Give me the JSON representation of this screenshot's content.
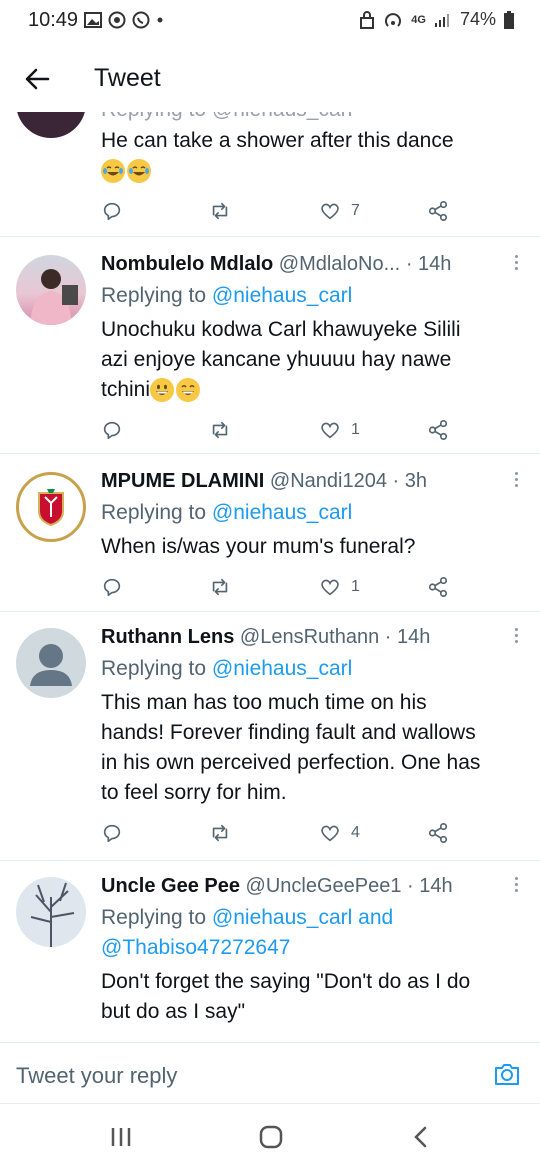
{
  "status": {
    "time": "10:49",
    "network": "4G",
    "battery": "74%"
  },
  "header": {
    "title": "Tweet"
  },
  "tweets": [
    {
      "partial_reply": "Replying to @niehaus_carl",
      "text": "He can take a shower after this dance",
      "emojis": [
        "joy-emoji",
        "joy-emoji"
      ],
      "likes": "7"
    },
    {
      "name": "Nombulelo Mdlalo",
      "handle": "@MdlaloNo...",
      "time": "· 14h",
      "replying_prefix": "Replying to",
      "mention": "@niehaus_carl",
      "text": "Unochuku kodwa Carl khawuyeke Sililiazi enjoye kancane yhuuuu hay nawetchini",
      "text_lines": [
        "Unochuku kodwa Carl khawuyeke Silili",
        "azi enjoye kancane yhuuuu hay nawe",
        "tchini"
      ],
      "emojis": [
        "grinning-emoji",
        "grin-emoji"
      ],
      "likes": "1"
    },
    {
      "name": "MPUME DLAMINI",
      "handle": "@Nandi1204",
      "time": "· 3h",
      "replying_prefix": "Replying to",
      "mention": "@niehaus_carl",
      "text": "When is/was your mum's funeral?",
      "likes": "1"
    },
    {
      "name": "Ruthann Lens",
      "handle": "@LensRuthann",
      "time": "· 14h",
      "replying_prefix": "Replying to",
      "mention": "@niehaus_carl",
      "text_lines": [
        "This man has too much time on his",
        "hands! Forever finding fault and wallows",
        "in his own perceived perfection. One has",
        "to feel sorry for him."
      ],
      "likes": "4"
    },
    {
      "name": "Uncle Gee Pee",
      "handle": "@UncleGeePee1",
      "time": "· 14h",
      "replying_prefix": "Replying to",
      "mention": "@niehaus_carl and",
      "mention2": "@Thabiso47272647",
      "text_lines": [
        "Don't forget the saying \"Don't do as I do",
        "but do as I say\""
      ]
    }
  ],
  "reply_bar": {
    "placeholder": "Tweet your reply"
  },
  "colors": {
    "accent": "#1d9bf0",
    "text": "#0f1419",
    "secondary": "#536471",
    "divider": "#e6ecf0"
  }
}
